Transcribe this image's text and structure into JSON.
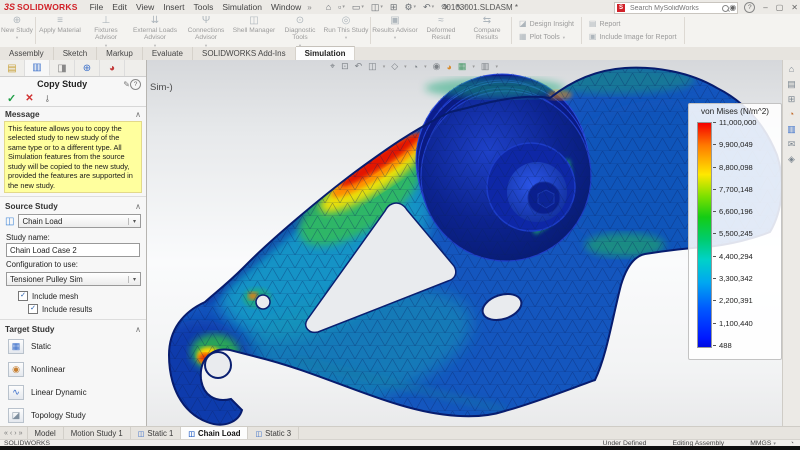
{
  "titlebar": {
    "logo": "SOLIDWORKS",
    "logo_mark": "3S",
    "menus": [
      "File",
      "Edit",
      "View",
      "Insert",
      "Tools",
      "Simulation",
      "Window"
    ],
    "title": "40103001.SLDASM *",
    "search_placeholder": "Search MySolidWorks"
  },
  "ribbon": {
    "buttons": [
      "New Study",
      "Apply Material",
      "Fixtures Advisor",
      "External Loads Advisor",
      "Connections Advisor",
      "Shell Manager",
      "Diagnostic Tools",
      "Run This Study",
      "Results Advisor",
      "Deformed Result",
      "Compare Results"
    ],
    "side_buttons": [
      "Design Insight",
      "Plot Tools",
      "Report",
      "Include Image for Report"
    ]
  },
  "tabs": {
    "items": [
      "Assembly",
      "Sketch",
      "Markup",
      "Evaluate",
      "SOLIDWORKS Add-Ins",
      "Simulation"
    ],
    "active": "Simulation"
  },
  "panel": {
    "title": "Copy Study",
    "message_header": "Message",
    "message": "This feature allows you to copy the selected study to new study of the same type or to a different type. All Simulation features from the source study will be copied to the new study, provided the features are supported in the new study.",
    "source_header": "Source Study",
    "source_value": "Chain Load",
    "study_name_label": "Study name:",
    "study_name": "Chain Load Case 2",
    "config_label": "Configuration to use:",
    "config_value": "Tensioner Pulley Sim",
    "include_mesh": "Include mesh",
    "include_results": "Include results",
    "target_header": "Target Study",
    "targets": [
      "Static",
      "Nonlinear",
      "Linear Dynamic",
      "Topology Study"
    ]
  },
  "viewport": {
    "partial_plot_label": "Sim-)",
    "legend": {
      "title": "von Mises (N/m^2)",
      "values": [
        "11,000,000",
        "9,900,049",
        "8,800,098",
        "7,700,148",
        "6,600,196",
        "5,500,245",
        "4,400,294",
        "3,300,342",
        "2,200,391",
        "1,100,440",
        "488"
      ]
    }
  },
  "bottom": {
    "tabs": [
      "Model",
      "Motion Study 1",
      "Static 1",
      "Chain Load",
      "Static 3"
    ],
    "active": "Chain Load"
  },
  "statusbar": {
    "app": "SOLIDWORKS",
    "define_state": "Under Defined",
    "mode": "Editing Assembly",
    "units": "MMGS"
  },
  "colors": {
    "brand_red": "#d12229",
    "stress_max": "#f40000",
    "stress_min": "#0018ff",
    "message_bg": "#ffff9e",
    "ok_green": "#1e9e46",
    "cancel_red": "#d03030"
  },
  "glyphs": {
    "qat": [
      "⌂",
      "▫",
      "▭",
      "◫",
      "⊞",
      "⚙",
      "↶",
      "↷",
      "↖"
    ],
    "ribbon": [
      "⊕",
      "≡",
      "⊥",
      "⇊",
      "Ψ",
      "◫",
      "⊙",
      "◎",
      "▣",
      "≈",
      "⇆"
    ],
    "side": [
      "◪",
      "▦",
      "▤",
      "▣"
    ],
    "headsup": [
      "⌖",
      "⊡",
      "↶",
      "◫",
      "◇",
      "◔",
      "◉",
      "◕",
      "▦",
      "▥"
    ],
    "taskpane": [
      "⌂",
      "▤",
      "⊞",
      "◔",
      "▥",
      "✉",
      "◈"
    ],
    "paneltabs": [
      "▤",
      "▥",
      "◨",
      "⊕",
      "◕"
    ],
    "targets": [
      "▦",
      "◉",
      "∿",
      "◪"
    ],
    "check": "✓",
    "cross": "✕",
    "chevup": "∧",
    "chevdown": "▾",
    "help": "?",
    "pencil": "✎",
    "user": "◉",
    "minimize": "–",
    "maximize": "▢",
    "close": "✕",
    "pin": "⊸",
    "menu_pin": "»",
    "nav_first": "«",
    "nav_prev": "‹",
    "nav_next": "›",
    "nav_last": "»",
    "tab_study": "◫",
    "clock": "◔",
    "search_dd": "▾"
  }
}
